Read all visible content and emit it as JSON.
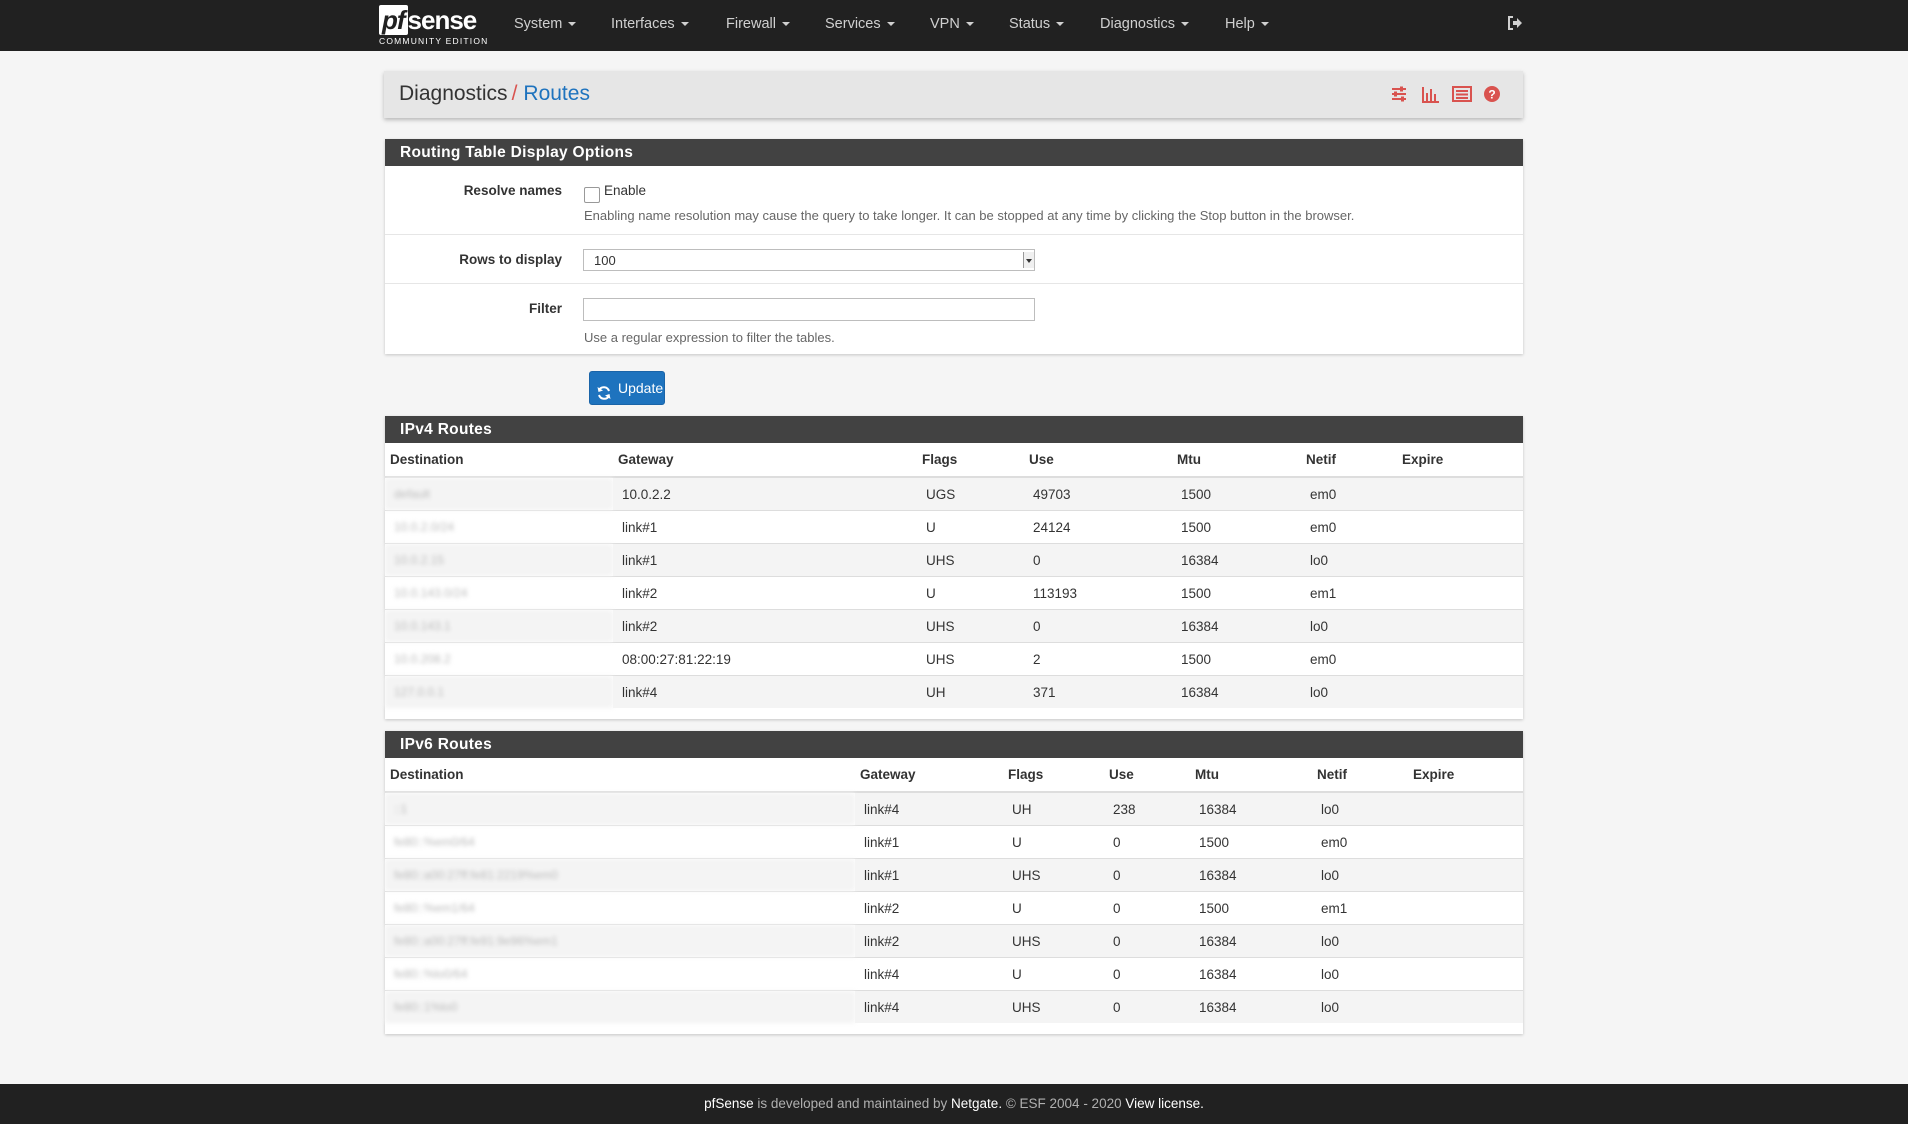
{
  "navbar": {
    "brand": "sense",
    "brand_prefix": "pf",
    "edition": "COMMUNITY EDITION",
    "items": [
      {
        "label": "System"
      },
      {
        "label": "Interfaces"
      },
      {
        "label": "Firewall"
      },
      {
        "label": "Services"
      },
      {
        "label": "VPN"
      },
      {
        "label": "Status"
      },
      {
        "label": "Diagnostics"
      },
      {
        "label": "Help"
      }
    ],
    "logout_icon": "sign-out-icon"
  },
  "header": {
    "crumb1": "Diagnostics",
    "separator": "/",
    "crumb2": "Routes",
    "icons": [
      "sliders-icon",
      "bar-chart-icon",
      "list-alt-icon",
      "question-circle-icon"
    ],
    "icon_color": "#d9534f"
  },
  "options_panel": {
    "title": "Routing Table Display Options",
    "resolve": {
      "label": "Resolve names",
      "checkbox_label": "Enable",
      "checked": false,
      "help": "Enabling name resolution may cause the query to take longer. It can be stopped at any time by clicking the Stop button in the browser."
    },
    "rows": {
      "label": "Rows to display",
      "value": "100"
    },
    "filter": {
      "label": "Filter",
      "value": "",
      "help": "Use a regular expression to filter the tables."
    }
  },
  "update_button": {
    "label": "Update",
    "icon": "refresh-icon",
    "color": "#1e73be"
  },
  "ipv4": {
    "title": "IPv4 Routes",
    "columns": [
      "Destination",
      "Gateway",
      "Flags",
      "Use",
      "Mtu",
      "Netif",
      "Expire"
    ],
    "rows": [
      {
        "destination": "default",
        "gateway": "10.0.2.2",
        "flags": "UGS",
        "use": "49703",
        "mtu": "1500",
        "netif": "em0",
        "expire": ""
      },
      {
        "destination": "10.0.2.0/24",
        "gateway": "link#1",
        "flags": "U",
        "use": "24124",
        "mtu": "1500",
        "netif": "em0",
        "expire": ""
      },
      {
        "destination": "10.0.2.15",
        "gateway": "link#1",
        "flags": "UHS",
        "use": "0",
        "mtu": "16384",
        "netif": "lo0",
        "expire": ""
      },
      {
        "destination": "10.0.143.0/24",
        "gateway": "link#2",
        "flags": "U",
        "use": "113193",
        "mtu": "1500",
        "netif": "em1",
        "expire": ""
      },
      {
        "destination": "10.0.143.1",
        "gateway": "link#2",
        "flags": "UHS",
        "use": "0",
        "mtu": "16384",
        "netif": "lo0",
        "expire": ""
      },
      {
        "destination": "10.0.208.2",
        "gateway": "08:00:27:81:22:19",
        "flags": "UHS",
        "use": "2",
        "mtu": "1500",
        "netif": "em0",
        "expire": ""
      },
      {
        "destination": "127.0.0.1",
        "gateway": "link#4",
        "flags": "UH",
        "use": "371",
        "mtu": "16384",
        "netif": "lo0",
        "expire": ""
      }
    ]
  },
  "ipv6": {
    "title": "IPv6 Routes",
    "columns": [
      "Destination",
      "Gateway",
      "Flags",
      "Use",
      "Mtu",
      "Netif",
      "Expire"
    ],
    "rows": [
      {
        "destination": "::1",
        "gateway": "link#4",
        "flags": "UH",
        "use": "238",
        "mtu": "16384",
        "netif": "lo0",
        "expire": ""
      },
      {
        "destination": "fe80::%em0/64",
        "gateway": "link#1",
        "flags": "U",
        "use": "0",
        "mtu": "1500",
        "netif": "em0",
        "expire": ""
      },
      {
        "destination": "fe80::a00:27ff:fe81:2219%em0",
        "gateway": "link#1",
        "flags": "UHS",
        "use": "0",
        "mtu": "16384",
        "netif": "lo0",
        "expire": ""
      },
      {
        "destination": "fe80::%em1/64",
        "gateway": "link#2",
        "flags": "U",
        "use": "0",
        "mtu": "1500",
        "netif": "em1",
        "expire": ""
      },
      {
        "destination": "fe80::a00:27ff:fe91:9e96%em1",
        "gateway": "link#2",
        "flags": "UHS",
        "use": "0",
        "mtu": "16384",
        "netif": "lo0",
        "expire": ""
      },
      {
        "destination": "fe80::%lo0/64",
        "gateway": "link#4",
        "flags": "U",
        "use": "0",
        "mtu": "16384",
        "netif": "lo0",
        "expire": ""
      },
      {
        "destination": "fe80::1%lo0",
        "gateway": "link#4",
        "flags": "UHS",
        "use": "0",
        "mtu": "16384",
        "netif": "lo0",
        "expire": ""
      }
    ]
  },
  "footer": {
    "brand": "pfSense",
    "text1": " is developed and maintained by ",
    "company": "Netgate.",
    "text2": " © ESF 2004 - 2020 ",
    "license": "View license."
  }
}
